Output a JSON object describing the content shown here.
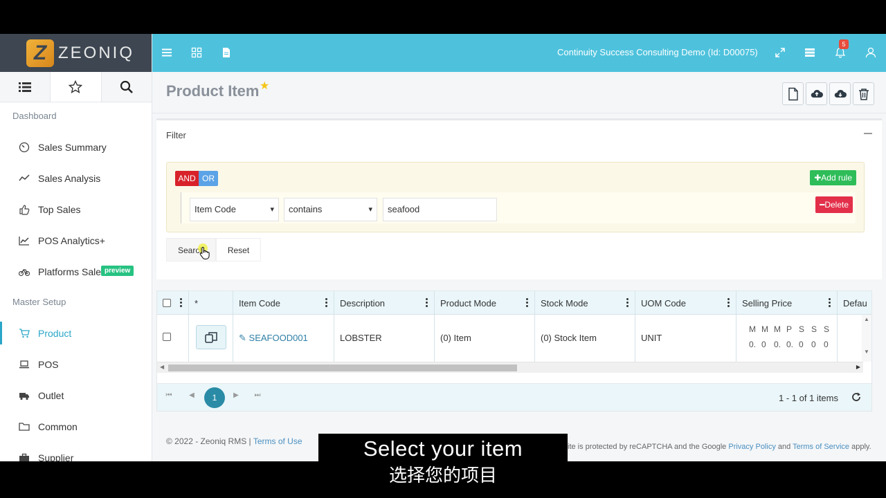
{
  "brand": {
    "name": "ZEONIQ",
    "mark": "Z"
  },
  "topbar": {
    "title": "Continuity Success Consulting Demo (Id: D00075)",
    "notification_count": "5"
  },
  "sidebar": {
    "sections": [
      {
        "label": "Dashboard"
      },
      {
        "label": "Master Setup"
      }
    ],
    "dashboard_items": [
      {
        "label": "Sales Summary",
        "icon": "gauge-icon"
      },
      {
        "label": "Sales Analysis",
        "icon": "trend-line-icon"
      },
      {
        "label": "Top Sales",
        "icon": "thumbs-up-icon"
      },
      {
        "label": "POS Analytics+",
        "icon": "area-chart-icon"
      },
      {
        "label": "Platforms Sale",
        "icon": "bicycle-icon",
        "badge": "preview"
      }
    ],
    "master_items": [
      {
        "label": "Product",
        "icon": "cart-icon",
        "active": true
      },
      {
        "label": "POS",
        "icon": "laptop-icon"
      },
      {
        "label": "Outlet",
        "icon": "truck-icon"
      },
      {
        "label": "Common",
        "icon": "folder-icon"
      },
      {
        "label": "Supplier",
        "icon": "briefcase-icon"
      }
    ]
  },
  "page": {
    "title": "Product Item",
    "favorite": true
  },
  "filter": {
    "title": "Filter",
    "and_label": "AND",
    "or_label": "OR",
    "add_rule_label": "Add rule",
    "delete_label": "Delete",
    "rule": {
      "field": "Item Code",
      "operator": "contains",
      "value": "seafood"
    },
    "search_label": "Search",
    "reset_label": "Reset"
  },
  "grid": {
    "columns": [
      "*",
      "Item Code",
      "Description",
      "Product Mode",
      "Stock Mode",
      "UOM Code",
      "Selling Price",
      "Defau"
    ],
    "rows": [
      {
        "item_code": "SEAFOOD001",
        "description": "LOBSTER",
        "product_mode": "(0) Item",
        "stock_mode": "(0) Stock Item",
        "uom_code": "UNIT",
        "selling_price_headers": [
          "M",
          "M",
          "M",
          "P",
          "S",
          "S",
          "S"
        ],
        "selling_price_values": [
          "0.",
          "0",
          "0.",
          "0.",
          "0",
          "0",
          "0"
        ]
      }
    ]
  },
  "pager": {
    "current_page": "1",
    "info": "1 - 1 of 1 items"
  },
  "footer": {
    "copyright": "© 2022 - Zeoniq RMS |",
    "terms_of_use": "Terms of Use",
    "recaptcha_prefix": "ite is protected by reCAPTCHA and the Google",
    "privacy_policy": "Privacy Policy",
    "and_text": "and",
    "terms_of_service": "Terms of Service",
    "apply_text": "apply."
  },
  "subtitles": {
    "english": "Select your item",
    "chinese": "选择您的项目"
  },
  "colors": {
    "topbar": "#4ec2dd",
    "accent": "#2aa6c8",
    "and": "#d8222a",
    "or": "#5ba3e6",
    "add_rule": "#2ebd59",
    "delete": "#e3304a"
  }
}
